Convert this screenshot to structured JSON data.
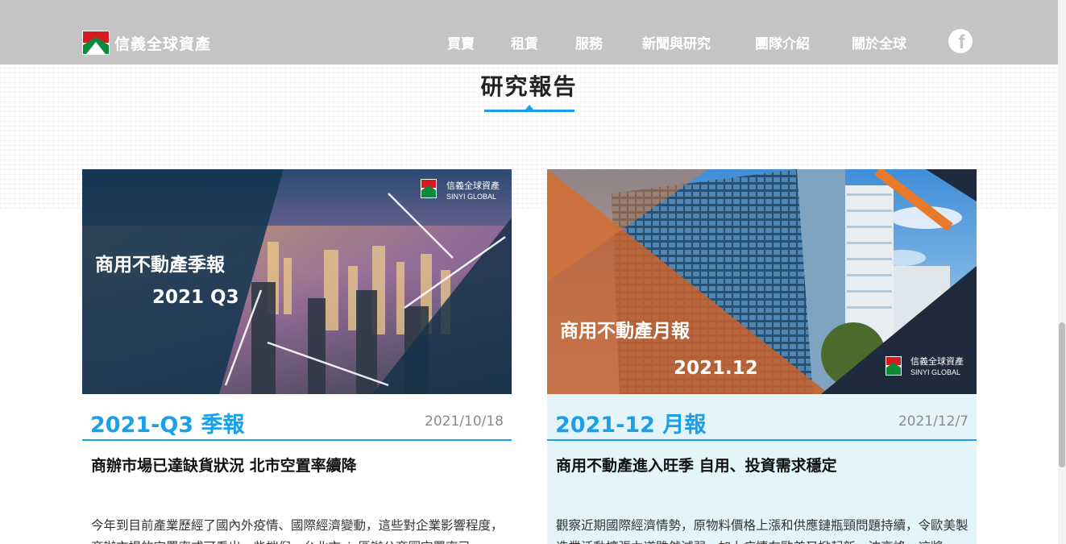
{
  "header": {
    "brand": "信義全球資產",
    "nav": [
      "買賣",
      "租賃",
      "服務",
      "新聞與研究",
      "團隊介紹",
      "關於全球"
    ],
    "social_icon": "facebook-icon"
  },
  "section": {
    "title": "研究報告"
  },
  "cards": [
    {
      "tag": "2021-Q3 季報",
      "date": "2021/10/18",
      "title": "商辦市場已達缺貨狀況 北市空置率續降",
      "excerpt": "今年到目前產業歷經了國內外疫情、國際經濟變動，這些對企業影響程度，商辦市場的空置率或可看出一些端倪，台北市six區辦公商圈空置率已",
      "image": {
        "headline": "商用不動產季報",
        "period": "2021 Q3",
        "logo_cn": "信義全球資產",
        "logo_en": "SINYI GLOBAL"
      }
    },
    {
      "tag": "2021-12 月報",
      "date": "2021/12/7",
      "title": "商用不動產進入旺季 自用、投資需求穩定",
      "excerpt": "觀察近期國際經濟情勢，原物料價格上漲和供應鏈瓶頸問題持續，令歐美製造業活動擴張力道雖然減弱，加上疫情在歐美又掀起新一波高峰，這將",
      "image": {
        "headline": "商用不動產月報",
        "period": "2021.12",
        "logo_cn": "信義全球資產",
        "logo_en": "SINYI GLOBAL"
      }
    }
  ],
  "colors": {
    "accent": "#1aa0ea",
    "header_bg": "#c4c4c4",
    "brand_red": "#d71920",
    "brand_green": "#0c8a3c",
    "orange": "#e8782a"
  }
}
